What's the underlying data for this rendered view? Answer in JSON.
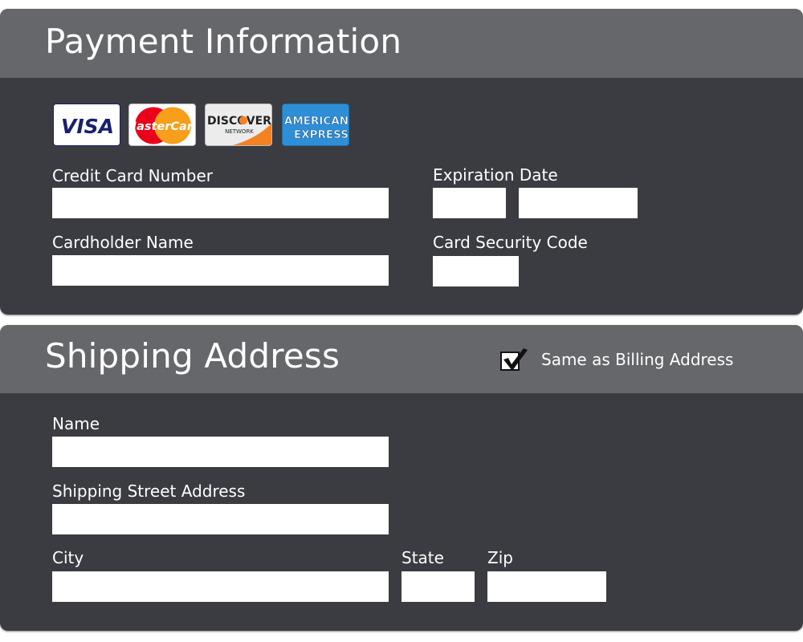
{
  "payment": {
    "title": "Payment Information",
    "cards": [
      {
        "name": "visa",
        "text": "VISA"
      },
      {
        "name": "mastercard",
        "text": "MasterCard"
      },
      {
        "name": "discover",
        "text": "DISCOVER",
        "subtext": "NETWORK"
      },
      {
        "name": "amex",
        "line1": "AMERICAN",
        "line2": "EXPRESS"
      }
    ],
    "card_number_label": "Credit Card Number",
    "card_number_value": "",
    "expiration_label": "Expiration Date",
    "exp_month_value": "",
    "exp_year_value": "",
    "cardholder_label": "Cardholder Name",
    "cardholder_value": "",
    "security_code_label": "Card Security Code",
    "security_code_value": ""
  },
  "shipping": {
    "title": "Shipping Address",
    "same_as_billing_label": "Same as Billing Address",
    "same_as_billing_checked": true,
    "name_label": "Name",
    "name_value": "",
    "street_label": "Shipping Street Address",
    "street_value": "",
    "city_label": "City",
    "city_value": "",
    "state_label": "State",
    "state_value": "",
    "zip_label": "Zip",
    "zip_value": ""
  },
  "colors": {
    "panel_body": "#3a3c41",
    "panel_header": "#65676b",
    "text": "#ffffff",
    "input_bg": "#ffffff"
  }
}
